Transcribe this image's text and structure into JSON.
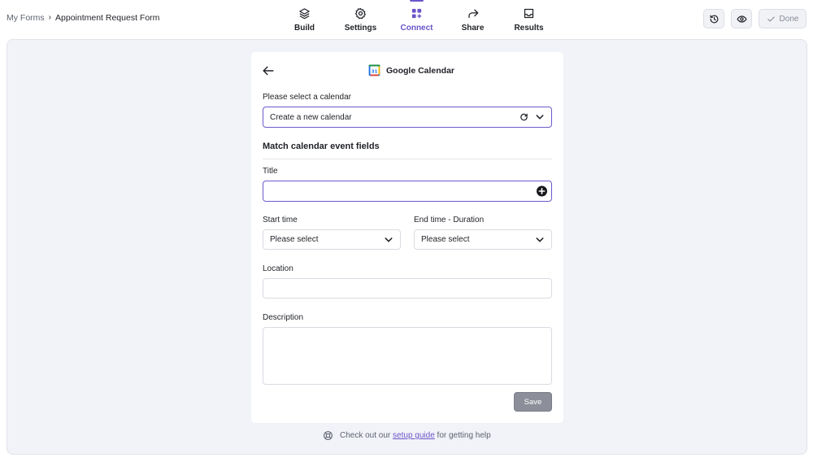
{
  "breadcrumb": {
    "root": "My Forms",
    "separator": "›",
    "current": "Appointment Request Form"
  },
  "nav": [
    {
      "label": "Build",
      "icon": "layers-icon"
    },
    {
      "label": "Settings",
      "icon": "gear-icon"
    },
    {
      "label": "Connect",
      "icon": "grid-plus-icon",
      "active": true
    },
    {
      "label": "Share",
      "icon": "share-arrow-icon"
    },
    {
      "label": "Results",
      "icon": "inbox-icon"
    }
  ],
  "toolbar": {
    "done_label": "Done"
  },
  "card": {
    "title": "Google Calendar",
    "calendar_label": "Please select a calendar",
    "calendar_value": "Create a new calendar",
    "section_title": "Match calendar event fields",
    "title_label": "Title",
    "title_value": "",
    "start_label": "Start time",
    "start_value": "Please select",
    "end_label": "End time - Duration",
    "end_value": "Please select",
    "location_label": "Location",
    "location_value": "",
    "description_label": "Description",
    "description_value": "",
    "save_label": "Save"
  },
  "help": {
    "prefix": "Check out our",
    "link": "setup guide",
    "suffix": "for getting help"
  },
  "colors": {
    "accent": "#6b55c9",
    "canvas": "#f2f3f8",
    "save_button": "#8c8e99"
  }
}
